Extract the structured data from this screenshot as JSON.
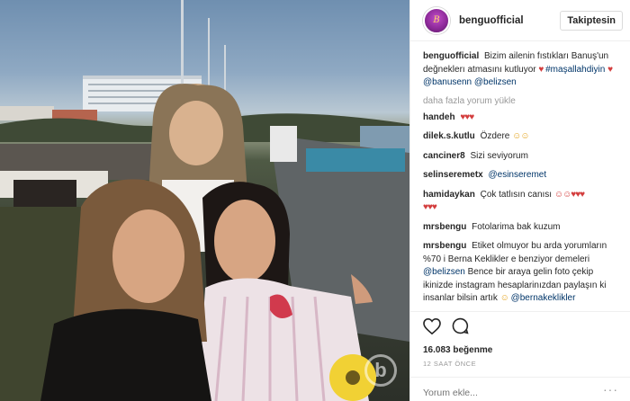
{
  "header": {
    "username": "benguofficial",
    "avatar_text": "B",
    "follow_label": "Takiptesin"
  },
  "photo": {
    "watermark": "b"
  },
  "caption": {
    "user": "benguofficial",
    "text": "Bizim ailenin fıstıkları Banuş'un değneklerı atmasını kutluyor",
    "emoji_1": "♥",
    "hashtag": "#maşallahdiyin",
    "emoji_2": "♥",
    "mention_1": "@banusenn",
    "mention_2": "@belizsen"
  },
  "load_more": "daha fazla yorum yükle",
  "comments": [
    {
      "user": "handeh",
      "text": "",
      "emoji": "♥♥♥"
    },
    {
      "user": "dilek.s.kutlu",
      "text": "Özdere",
      "emoji": "☺☺"
    },
    {
      "user": "canciner8",
      "text": "Sizi seviyorum",
      "emoji": ""
    },
    {
      "user": "selinseremetx",
      "text": "",
      "mention": "@esinseremet"
    },
    {
      "user": "hamidaykan",
      "text": "Çok tatlısın canısı",
      "emoji": "☺☺♥♥♥"
    },
    {
      "user": "",
      "text": "",
      "emoji": "♥♥♥"
    },
    {
      "user": "mrsbengu",
      "text": "Fotolarima bak kuzum",
      "emoji": ""
    },
    {
      "user": "mrsbengu",
      "text": "Etiket olmuyor bu arda yorumların %70 i Berna Keklikler e benziyor demeleri",
      "mention": "@belizsen",
      "text_2": "Bence bir araya gelin foto çekip ikinizde instagram hesaplarinızdan paylaşın ki insanlar bilsin artık",
      "emoji": "☺",
      "mention_2": "@bernakeklikler"
    }
  ],
  "actions": {
    "like_icon": "heart-icon",
    "comment_icon": "comment-icon",
    "likes": "16.083 beğenme",
    "time": "12 saat önce"
  },
  "add_comment": {
    "placeholder": "Yorum ekle...",
    "more": "···"
  },
  "colors": {
    "mention": "#003569",
    "muted": "#999999",
    "border": "#efefef"
  }
}
